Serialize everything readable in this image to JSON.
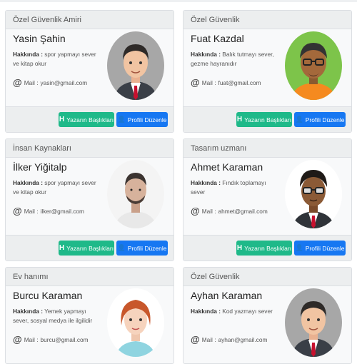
{
  "labels": {
    "about": "Hakkında :",
    "mail": "Mail :"
  },
  "buttons": {
    "titles": "Yazarın Başlıkları",
    "edit": "Profili Düzenle"
  },
  "icons": {
    "titles": "h-icon",
    "edit": "user-icon",
    "mail": "at-icon"
  },
  "colors": {
    "green": "#1fb989",
    "blue": "#1677f2"
  },
  "cards": [
    {
      "role": "Özel Güvenlik Amiri",
      "name": "Yasin Şahin",
      "about": "spor yapmayı sever ve kitap okur",
      "mail": "yasin@gmail.com",
      "avatar": "man-avatar-suit"
    },
    {
      "role": "Özel Güvenlik",
      "name": "Fuat Kazdal",
      "about": "Balık tutmayı sever, gezme hayranıdır",
      "mail": "fuat@gmail.com",
      "avatar": "man-avatar-glasses-beard"
    },
    {
      "role": "İnsan Kaynakları",
      "name": "İlker Yiğitalp",
      "about": "spor yapmayı sever ve kitap okur",
      "mail": "ilker@gmail.com",
      "avatar": "man-photo"
    },
    {
      "role": "Tasarım uzmanı",
      "name": "Ahmet Karaman",
      "about": "Fındık toplamayı sever",
      "mail": "ahmet@gmail.com",
      "avatar": "man-avatar-curly-glasses"
    },
    {
      "role": "Ev hanımı",
      "name": "Burcu Karaman",
      "about": "Yemek yapmayı sever, sosyal medya ile ilgilidir",
      "mail": "burcu@gmail.com",
      "avatar": "woman-avatar"
    },
    {
      "role": "Özel Güvenlik",
      "name": "Ayhan Karaman",
      "about": "Kod yazmayı sever",
      "mail": "ayhan@gmail.com",
      "avatar": "man-avatar-suit"
    }
  ]
}
